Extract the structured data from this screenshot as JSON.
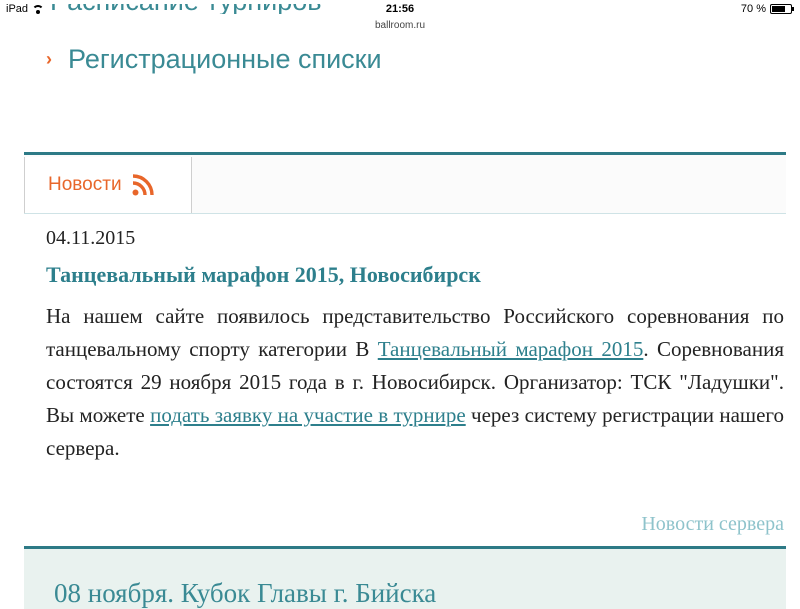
{
  "status_bar": {
    "device": "iPad",
    "time": "21:56",
    "url": "ballroom.ru",
    "battery_text": "70 %",
    "battery_level": 0.7,
    "wifi_icon": "wifi-icon"
  },
  "nav": {
    "cut_item": "Расписание турниров",
    "registration_lists": "Регистрационные списки",
    "chevron_icon": "chevron-right-icon"
  },
  "news": {
    "tab_label": "Новости",
    "rss_icon": "rss-icon",
    "date": "04.11.2015",
    "headline": "Танцевальный марафон 2015, Новосибирск",
    "body_part1": "На нашем сайте появилось представительство Российского соревнования по танцевальному спорту категории В ",
    "body_link1": "Танцевальный марафон 2015",
    "body_part2": ". Соревнования состоятся 29 ноября 2015 года в г. Новосибирск. Организатор: ТСК \"Ладушки\". Вы можете ",
    "body_link2": "подать заявку на участие в турнире",
    "body_part3": " через систему регистрации нашего сервера.",
    "server_news_link": "Новости сервера"
  },
  "next_panel": {
    "title": "08 ноября. Кубок Главы г. Бийска"
  },
  "colors": {
    "accent": "#e8662a",
    "link": "#2d7f8c",
    "border": "#2d7a86"
  }
}
